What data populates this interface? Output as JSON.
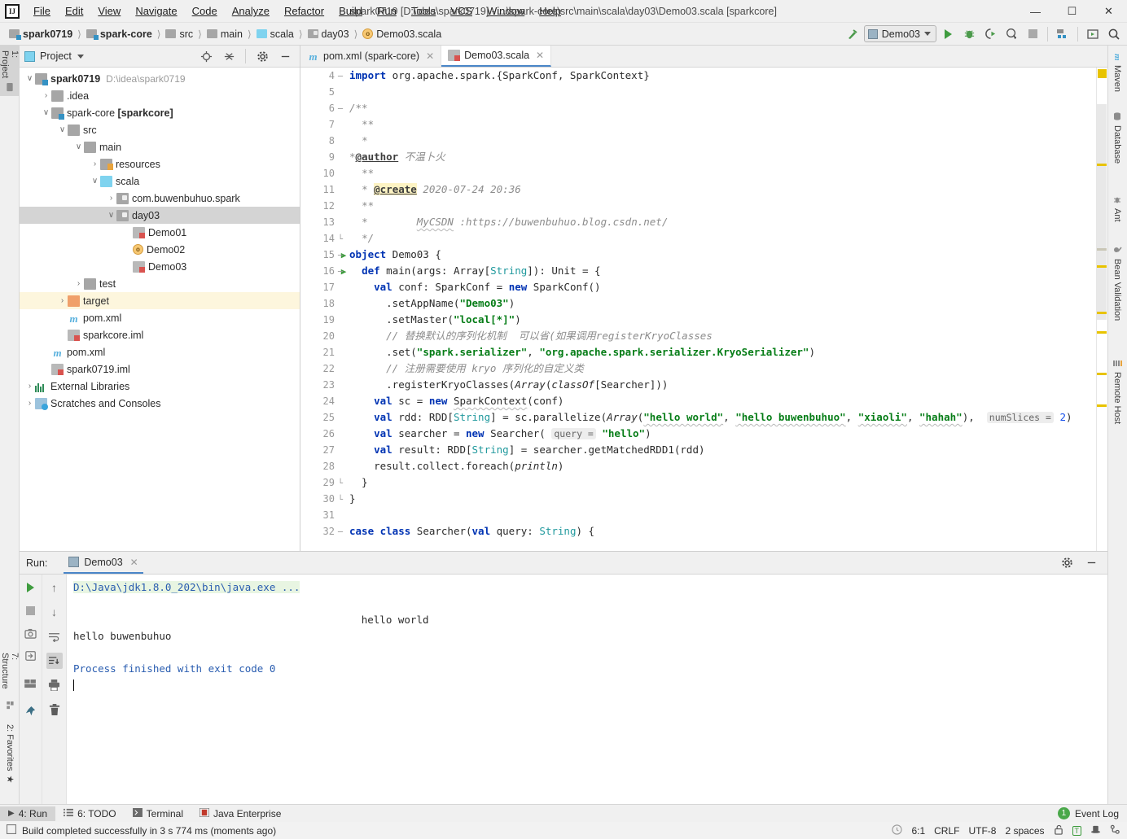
{
  "window": {
    "title": "spark0719 [D:\\idea\\spark0719] - ...\\spark-core\\src\\main\\scala\\day03\\Demo03.scala [sparkcore]",
    "minimize": "—",
    "maximize": "☐",
    "close": "✕",
    "logo": "IJ"
  },
  "menubar": [
    {
      "label": "File"
    },
    {
      "label": "Edit"
    },
    {
      "label": "View"
    },
    {
      "label": "Navigate"
    },
    {
      "label": "Code"
    },
    {
      "label": "Analyze"
    },
    {
      "label": "Refactor"
    },
    {
      "label": "Build"
    },
    {
      "label": "Run"
    },
    {
      "label": "Tools"
    },
    {
      "label": "VCS"
    },
    {
      "label": "Window"
    },
    {
      "label": "Help"
    }
  ],
  "breadcrumb": [
    {
      "label": "spark0719",
      "icon": "module-folder-icon",
      "bold": true
    },
    {
      "label": "spark-core",
      "icon": "module-folder-icon",
      "bold": true
    },
    {
      "label": "src",
      "icon": "folder-icon",
      "bold": false
    },
    {
      "label": "main",
      "icon": "folder-icon",
      "bold": false
    },
    {
      "label": "scala",
      "icon": "source-folder-icon",
      "bold": false
    },
    {
      "label": "day03",
      "icon": "package-folder-icon",
      "bold": false
    },
    {
      "label": "Demo03.scala",
      "icon": "scala-object-icon",
      "bold": false
    }
  ],
  "toolbar": {
    "run_config": "Demo03",
    "build_icon": "hammer-icon",
    "run_icon": "run-icon",
    "debug_icon": "debug-bug-icon",
    "run_coverage_icon": "run-with-coverage-icon",
    "profile_icon": "profiler-icon",
    "stop_icon": "stop-icon",
    "project_structure_icon": "project-structure-icon",
    "updates_icon": "update-project-icon",
    "search_icon": "search-everywhere-icon"
  },
  "left_strip": [
    {
      "label": "1: Project",
      "icon": "project-folder-icon",
      "selected": true
    },
    {
      "label": "7: Structure",
      "icon": "structure-icon",
      "selected": false
    },
    {
      "label": "2: Favorites",
      "icon": "star-icon",
      "selected": false
    }
  ],
  "right_strip": [
    {
      "label": "Maven",
      "icon": "maven-m-icon"
    },
    {
      "label": "Database",
      "icon": "database-icon"
    },
    {
      "label": "Ant",
      "icon": "ant-icon"
    },
    {
      "label": "Bean Validation",
      "icon": "bean-validation-icon"
    },
    {
      "label": "Remote Host",
      "icon": "remote-host-icon"
    }
  ],
  "project_panel": {
    "title": "Project",
    "dropdown_icon": "chevron-down-icon",
    "tools": [
      "locate-icon",
      "collapse-all-icon",
      "settings-gear-icon",
      "hide-icon"
    ],
    "tree": [
      {
        "depth": 0,
        "arrow": "∨",
        "icon": "module-folder-icon",
        "label": "spark0719",
        "sub": "D:\\idea\\spark0719",
        "bold": true,
        "state": ""
      },
      {
        "depth": 1,
        "arrow": "›",
        "icon": "folder-icon",
        "label": ".idea",
        "sub": "",
        "bold": false,
        "state": ""
      },
      {
        "depth": 1,
        "arrow": "∨",
        "icon": "module-folder-icon",
        "label": "spark-core [sparkcore]",
        "sub": "",
        "bold": false,
        "state": ""
      },
      {
        "depth": 2,
        "arrow": "∨",
        "icon": "folder-icon",
        "label": "src",
        "sub": "",
        "bold": false,
        "state": ""
      },
      {
        "depth": 3,
        "arrow": "∨",
        "icon": "folder-icon",
        "label": "main",
        "sub": "",
        "bold": false,
        "state": ""
      },
      {
        "depth": 4,
        "arrow": "›",
        "icon": "resources-folder-icon",
        "label": "resources",
        "sub": "",
        "bold": false,
        "state": ""
      },
      {
        "depth": 4,
        "arrow": "∨",
        "icon": "source-folder-icon",
        "label": "scala",
        "sub": "",
        "bold": false,
        "state": ""
      },
      {
        "depth": 5,
        "arrow": "›",
        "icon": "package-folder-icon",
        "label": "com.buwenbuhuo.spark",
        "sub": "",
        "bold": false,
        "state": ""
      },
      {
        "depth": 5,
        "arrow": "∨",
        "icon": "package-folder-icon",
        "label": "day03",
        "sub": "",
        "bold": false,
        "state": "sel"
      },
      {
        "depth": 6,
        "arrow": "",
        "icon": "scala-file-icon",
        "label": "Demo01",
        "sub": "",
        "bold": false,
        "state": ""
      },
      {
        "depth": 6,
        "arrow": "",
        "icon": "scala-object-icon",
        "label": "Demo02",
        "sub": "",
        "bold": false,
        "state": ""
      },
      {
        "depth": 6,
        "arrow": "",
        "icon": "scala-file-icon",
        "label": "Demo03",
        "sub": "",
        "bold": false,
        "state": ""
      },
      {
        "depth": 3,
        "arrow": "›",
        "icon": "folder-icon",
        "label": "test",
        "sub": "",
        "bold": false,
        "state": ""
      },
      {
        "depth": 2,
        "arrow": "›",
        "icon": "excluded-folder-icon",
        "label": "target",
        "sub": "",
        "bold": false,
        "state": "hl"
      },
      {
        "depth": 2,
        "arrow": "",
        "icon": "maven-file-icon",
        "label": "pom.xml",
        "sub": "",
        "bold": false,
        "state": ""
      },
      {
        "depth": 2,
        "arrow": "",
        "icon": "iml-file-icon",
        "label": "sparkcore.iml",
        "sub": "",
        "bold": false,
        "state": ""
      },
      {
        "depth": 1,
        "arrow": "",
        "icon": "maven-file-icon",
        "label": "pom.xml",
        "sub": "",
        "bold": false,
        "state": ""
      },
      {
        "depth": 1,
        "arrow": "",
        "icon": "iml-file-icon",
        "label": "spark0719.iml",
        "sub": "",
        "bold": false,
        "state": ""
      },
      {
        "depth": 0,
        "arrow": "›",
        "icon": "external-libraries-icon",
        "label": "External Libraries",
        "sub": "",
        "bold": false,
        "state": ""
      },
      {
        "depth": 0,
        "arrow": "›",
        "icon": "scratches-icon",
        "label": "Scratches and Consoles",
        "sub": "",
        "bold": false,
        "state": ""
      }
    ]
  },
  "editor": {
    "tabs": [
      {
        "label": "pom.xml (spark-core)",
        "icon": "maven-file-icon",
        "active": false,
        "close": "✕"
      },
      {
        "label": "Demo03.scala",
        "icon": "scala-file-icon",
        "active": true,
        "close": "✕"
      }
    ],
    "first_line_number": 4,
    "lines": [
      {
        "n": 4,
        "html": "<span class=\"kw\">import</span> org.apache.spark.{SparkConf, SparkContext}",
        "fold": "minus",
        "run": false
      },
      {
        "n": 5,
        "html": "",
        "fold": "",
        "run": false
      },
      {
        "n": 6,
        "html": "<span class=\"doc\">/**</span>",
        "fold": "minus",
        "run": false
      },
      {
        "n": 7,
        "html": "  <span class=\"doc\">**</span>",
        "fold": "",
        "run": false
      },
      {
        "n": 8,
        "html": "  <span class=\"doc\">*</span>",
        "fold": "",
        "run": false
      },
      {
        "n": 9,
        "html": "<span class=\"doc\">*</span><span class=\"tag\">@author</span> <span class=\"doc\">不温卜火</span>",
        "fold": "",
        "run": false
      },
      {
        "n": 10,
        "html": "  <span class=\"doc\">**</span>",
        "fold": "",
        "run": false
      },
      {
        "n": 11,
        "html": "  <span class=\"doc\">* </span><span class=\"tagh\">@create</span><span class=\"doc\"> 2020-07-24 20:36</span>",
        "fold": "",
        "run": false
      },
      {
        "n": 12,
        "html": "  <span class=\"doc\">**</span>",
        "fold": "",
        "run": false
      },
      {
        "n": 13,
        "html": "  <span class=\"doc\">*        <span class=\"squig\">MyCSDN</span> :https://buwenbuhuo.blog.csdn.net/</span>",
        "fold": "",
        "run": false
      },
      {
        "n": 14,
        "html": "  <span class=\"doc\">*/</span>",
        "fold": "plus",
        "run": false
      },
      {
        "n": 15,
        "html": "<span class=\"kw\">object</span> Demo03 {",
        "fold": "minus",
        "run": true
      },
      {
        "n": 16,
        "html": "  <span class=\"kw\">def</span> main(args: Array[<span class=\"typ\">String</span>]): Unit = {",
        "fold": "minus",
        "run": true
      },
      {
        "n": 17,
        "html": "    <span class=\"kw\">val</span> conf: SparkConf = <span class=\"kw\">new</span> SparkConf()",
        "fold": "",
        "run": false
      },
      {
        "n": 18,
        "html": "      .setAppName(<span class=\"str\">\"Demo03\"</span>)",
        "fold": "",
        "run": false
      },
      {
        "n": 19,
        "html": "      .setMaster(<span class=\"str\">\"local[*]\"</span>)",
        "fold": "",
        "run": false
      },
      {
        "n": 20,
        "html": "      <span class=\"cmt\">// 替换默认的序列化机制  可以省(如果调用registerKryoClasses</span>",
        "fold": "",
        "run": false
      },
      {
        "n": 21,
        "html": "      .set(<span class=\"str\">\"spark.serializer\"</span>, <span class=\"str\">\"org.apache.spark.serializer.KryoSerializer\"</span>)",
        "fold": "",
        "run": false
      },
      {
        "n": 22,
        "html": "      <span class=\"cmt\">// 注册需要使用 kryo 序列化的自定义类</span>",
        "fold": "",
        "run": false
      },
      {
        "n": 23,
        "html": "      .registerKryoClasses(<span class=\"ital\">Array</span>(<span class=\"ital\">classOf</span>[Searcher]))",
        "fold": "",
        "run": false
      },
      {
        "n": 24,
        "html": "    <span class=\"kw\">val</span> sc = <span class=\"kw\">new</span> <span class=\"squig\">SparkContext</span>(conf)",
        "fold": "",
        "run": false
      },
      {
        "n": 25,
        "html": "    <span class=\"kw\">val</span> rdd: RDD[<span class=\"typ\">String</span>] = sc.parallelize(<span class=\"ital\">Array</span>(<span class=\"str squig\">\"hello world\"</span>, <span class=\"str squig\">\"hello buwenbuhuo\"</span>, <span class=\"str squig\">\"xiaoli\"</span>, <span class=\"str squig\">\"hahah\"</span>),&nbsp; <span class=\"hint\">numSlices =</span> <span class=\"num\">2</span>)",
        "fold": "",
        "run": false
      },
      {
        "n": 26,
        "html": "    <span class=\"kw\">val</span> searcher = <span class=\"kw\">new</span> Searcher( <span class=\"hint\">query =</span> <span class=\"str\">\"hello\"</span>)",
        "fold": "",
        "run": false
      },
      {
        "n": 27,
        "html": "    <span class=\"kw\">val</span> result: RDD[<span class=\"typ\">String</span>] = searcher.getMatchedRDD1(rdd)",
        "fold": "",
        "run": false
      },
      {
        "n": 28,
        "html": "    result.collect.foreach(<span class=\"ital\">println</span>)",
        "fold": "",
        "run": false
      },
      {
        "n": 29,
        "html": "  }",
        "fold": "plus",
        "run": false
      },
      {
        "n": 30,
        "html": "}",
        "fold": "plus",
        "run": false
      },
      {
        "n": 31,
        "html": "",
        "fold": "",
        "run": false
      },
      {
        "n": 32,
        "html": "<span class=\"kw\">case class</span> Searcher(<span class=\"kw\">val</span> query: <span class=\"typ\">String</span>) {",
        "fold": "minus",
        "run": false
      }
    ]
  },
  "run_panel": {
    "label": "Run:",
    "tab": "Demo03",
    "tab_close": "✕",
    "header_tools": [
      "settings-gear-icon",
      "hide-icon"
    ],
    "toolbar_left": [
      "rerun-icon",
      "stop-icon",
      "screenshot-icon",
      "export-icon",
      "layout-icon",
      "pin-icon"
    ],
    "toolbar_right": [
      "scroll-up-icon",
      "scroll-down-icon",
      "soft-wrap-icon",
      "scroll-to-end-icon",
      "print-icon",
      "clear-all-icon"
    ],
    "console": [
      {
        "text": "D:\\Java\\jdk1.8.0_202\\bin\\java.exe ...",
        "style": "blue-hl",
        "indent": 0
      },
      {
        "text": "",
        "style": "",
        "indent": 0
      },
      {
        "text": "hello world",
        "style": "",
        "indent": 47
      },
      {
        "text": "hello buwenbuhuo",
        "style": "",
        "indent": 0
      },
      {
        "text": "",
        "style": "",
        "indent": 0
      },
      {
        "text": "Process finished with exit code 0",
        "style": "blue",
        "indent": 0
      }
    ]
  },
  "bottom_strip": {
    "tabs": [
      {
        "label": "4: Run",
        "icon": "run-icon",
        "selected": true
      },
      {
        "label": "6: TODO",
        "icon": "todo-list-icon",
        "selected": false
      },
      {
        "label": "Terminal",
        "icon": "terminal-icon",
        "selected": false
      },
      {
        "label": "Java Enterprise",
        "icon": "java-enterprise-icon",
        "selected": false
      }
    ],
    "event_log": "Event Log",
    "event_count": "1"
  },
  "status_bar": {
    "message": "Build completed successfully in 3 s 774 ms (moments ago)",
    "message_icon": "build-icon",
    "caret": "6:1",
    "line_sep": "CRLF",
    "encoding": "UTF-8",
    "indent": "2 spaces",
    "lock_icon": "unlocked-icon",
    "transparent_icon": "transparent-T-icon",
    "inspection_icon": "inspector-hat-icon",
    "vcs_icon": "vcs-branch-icon",
    "clock_icon": "clock-icon"
  },
  "colors": {
    "accent": "#4a86c8",
    "keyword": "#0033b3",
    "string": "#067d17",
    "comment": "#8c8c8c",
    "type": "#20999d",
    "number": "#1750eb",
    "run_green": "#3f9c3f",
    "marker_yellow": "#e8c300",
    "highlight_row": "#fdf6dd",
    "selected_row": "#d4d4d4"
  }
}
